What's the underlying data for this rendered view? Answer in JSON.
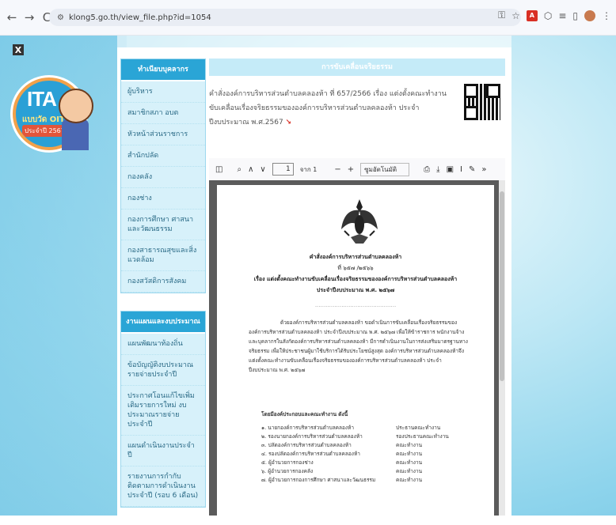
{
  "browser": {
    "url": "klong5.go.th/view_file.php?id=1054",
    "back": "←",
    "forward": "→",
    "reload": "C"
  },
  "close_label": "X",
  "badge": {
    "ita": "ITA",
    "oit": "แบบวัด OIT",
    "year": "ประจำปี 2567"
  },
  "sidebar": {
    "section1_title": "ทำเนียบบุคลากร",
    "section1_items": [
      "ผู้บริหาร",
      "สมาชิกสภา อบต",
      "หัวหน้าส่วนราชการ",
      "สำนักปลัด",
      "กองคลัง",
      "กองช่าง",
      "กองการศึกษา ศาสนาและวัฒนธรรม",
      "กองสาธารณสุขและสิ่งแวดล้อม",
      "กองสวัสดิการสังคม"
    ],
    "section2_title": "งานแผนและงบประมาณ",
    "section2_items": [
      "แผนพัฒนาท้องถิ่น",
      "ข้อบัญญัติงบประมาณรายจ่ายประจำปี",
      "ประกาศโอนแก้ไขเพิ่มเติมรายการใหม่ งบประมาณรายจ่ายประจำปี",
      "แผนดำเนินงานประจำปี",
      "รายงานการกำกับติดตามการดำเนินงานประจำปี (รอบ 6 เดือน)"
    ]
  },
  "content": {
    "header": "การขับเคลื่อนจริยธรรม",
    "description": "คำสั่งองค์การบริหารส่วนตำบลคลองห้า ที่ 657/2566 เรื่อง แต่งตั้งคณะทำงานขับเคลื่อนเรื่องจริยธรรมขององค์การบริหารส่วนตำบลคลองห้า ประจำปีงบประมาณ พ.ศ.2567"
  },
  "pdf_toolbar": {
    "page": "1",
    "page_of": "จาก 1",
    "zoom": "ซูมอัตโนมัติ"
  },
  "doc": {
    "org": "คำสั่งองค์การบริหารส่วนตำบลคลองห้า",
    "number": "ที่ ๖๕๗ /๒๕๖๖",
    "subject": "เรื่อง แต่งตั้งคณะทำงานขับเคลื่อนเรื่องจริยธรรมขององค์การบริหารส่วนตำบลคลองห้า",
    "fiscal": "ประจำปีงบประมาณ พ.ศ. ๒๕๖๗",
    "divider": "..............................................",
    "para": "ด้วยองค์การบริหารส่วนตำบลคลองห้า ขอดำเนินการขับเคลื่อนเรื่องจริยธรรมขององค์การบริหารส่วนตำบลคลองห้า ประจำปีงบประมาณ พ.ศ. ๒๕๖๗ เพื่อให้ข้าราชการ พนักงานจ้าง และบุคลากรในสังกัดองค์การบริหารส่วนตำบลคลองห้า มีการดำเนินงานในการส่งเสริมมาตรฐานทางจริยธรรม เพื่อให้ประชาชนผู้มาใช้บริการได้รับประโยชน์สูงสุด องค์การบริหารส่วนตำบลคลองห้าจึงแต่งตั้งคณะทำงานขับเคลื่อนเรื่องจริยธรรมขององค์การบริหารส่วนตำบลคลองห้า ประจำปีงบประมาณ พ.ศ. ๒๕๖๗",
    "list_title": "โดยมีองค์ประกอบและคณะทำงาน ดังนี้",
    "members": [
      {
        "name": "๑. นายกองค์การบริหารส่วนตำบลคลองห้า",
        "role": "ประธานคณะทำงาน"
      },
      {
        "name": "๒. รองนายกองค์การบริหารส่วนตำบลคลองห้า",
        "role": "รองประธานคณะทำงาน"
      },
      {
        "name": "๓. ปลัดองค์การบริหารส่วนตำบลคลองห้า",
        "role": "คณะทำงาน"
      },
      {
        "name": "๔. รองปลัดองค์การบริหารส่วนตำบลคลองห้า",
        "role": "คณะทำงาน"
      },
      {
        "name": "๕. ผู้อำนวยการกองช่าง",
        "role": "คณะทำงาน"
      },
      {
        "name": "๖. ผู้อำนวยการกองคลัง",
        "role": "คณะทำงาน"
      },
      {
        "name": "๗. ผู้อำนวยการกองการศึกษา ศาสนาและวัฒนธรรม",
        "role": "คณะทำงาน"
      }
    ]
  }
}
